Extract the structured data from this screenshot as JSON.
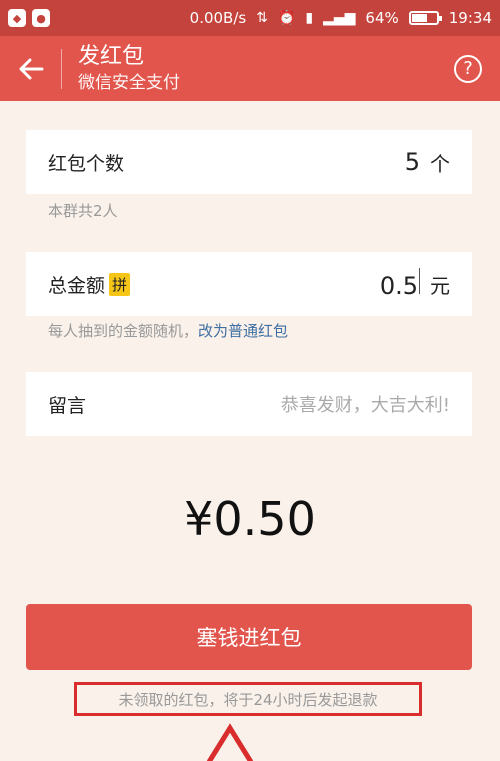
{
  "status_bar": {
    "speed": "0.00B/s",
    "battery": "64%",
    "battery_level": 0.64,
    "time": "19:34"
  },
  "app_bar": {
    "title": "发红包",
    "subtitle": "微信安全支付"
  },
  "count_card": {
    "label": "红包个数",
    "value": "5",
    "unit": "个",
    "hint": "本群共2人"
  },
  "amount_card": {
    "label": "总金额",
    "badge": "拼",
    "value": "0.5",
    "unit": "元",
    "hint": "每人抽到的金额随机，",
    "hint_link": "改为普通红包"
  },
  "message_card": {
    "label": "留言",
    "placeholder": "恭喜发财，大吉大利!"
  },
  "total": "¥0.50",
  "submit_label": "塞钱进红包",
  "refund_note": "未领取的红包，将于24小时后发起退款",
  "colors": {
    "accent": "#e2554c",
    "status_bar": "#c4433c",
    "background": "#f9f1ea",
    "link": "#3f6fa2",
    "highlight": "#d92c2c"
  }
}
